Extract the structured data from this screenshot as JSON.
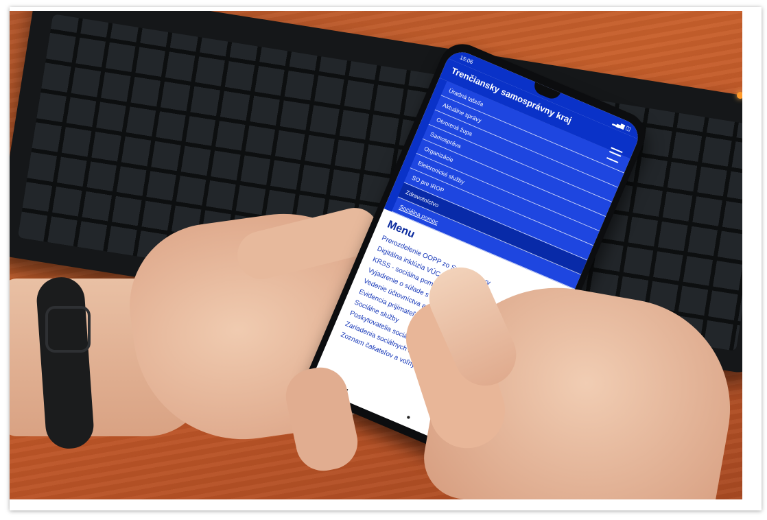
{
  "phone_screen": {
    "status_time": "15:06",
    "status_icons": "▂▄▆ ◫",
    "site_title": "Trenčiansky samosprávny kraj",
    "nav_items": [
      {
        "label": "Úradná tabuľa"
      },
      {
        "label": "Aktuálne správy"
      },
      {
        "label": "Otvorená župa"
      },
      {
        "label": "Samospráva"
      },
      {
        "label": "Organizácie"
      },
      {
        "label": "Elektronické služby"
      },
      {
        "label": "SO pre IROP"
      },
      {
        "label": "Zdravotníctvo"
      },
      {
        "label": "Sociálna pomoc"
      }
    ],
    "menu_title": "Menu",
    "menu_items": [
      {
        "label": "Prerozdelenie OOPP zo Správy rezerv"
      },
      {
        "label": "Digitálna inklúzia VÚC TN"
      },
      {
        "label": "KRSS - sociálna pomoc"
      },
      {
        "label": "Vyjadrenie o súlade s koncepciou"
      },
      {
        "label": "Vedenie účtovníctva a výročné správy"
      },
      {
        "label": "Evidencia prijímateľov sociálnych služieb"
      },
      {
        "label": "Sociálne služby"
      },
      {
        "label": "Poskytovatelia sociálnych služieb"
      },
      {
        "label": "Zariadenia sociálnych služieb TSK"
      },
      {
        "label": "Zoznam čakateľov a voľných miest v ZSS"
      }
    ],
    "android_nav": {
      "back": "◀",
      "home": "●",
      "recents": "■"
    }
  },
  "colors": {
    "brand_blue": "#0a32c8",
    "desk": "#c15a2a"
  }
}
